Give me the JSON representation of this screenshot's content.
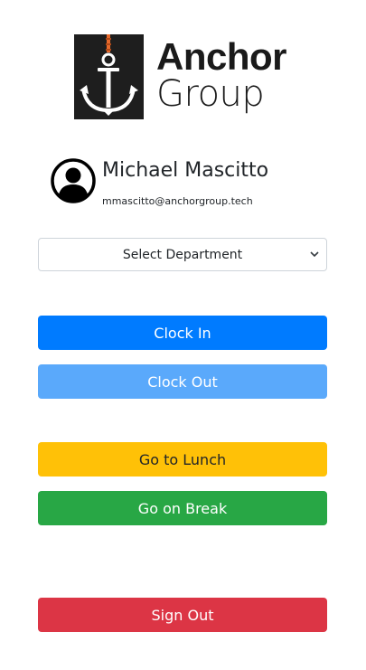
{
  "brand": {
    "line1": "Anchor",
    "line2": "Group",
    "icon": "anchor-icon"
  },
  "user": {
    "name": "Michael Mascitto",
    "email": "mmascitto@anchorgroup.tech",
    "avatar_icon": "user-circle-icon"
  },
  "department_select": {
    "selected": "Select Department"
  },
  "actions": {
    "clock_in": "Clock In",
    "clock_out": "Clock Out",
    "lunch": "Go to Lunch",
    "break": "Go on Break",
    "sign_out": "Sign Out"
  },
  "colors": {
    "primary": "#007bff",
    "primary_light": "#5aa9fb",
    "warning": "#ffc107",
    "success": "#28a745",
    "danger": "#dc3545",
    "logo_bg": "#1e1e1e",
    "rope": "#e8692b"
  }
}
